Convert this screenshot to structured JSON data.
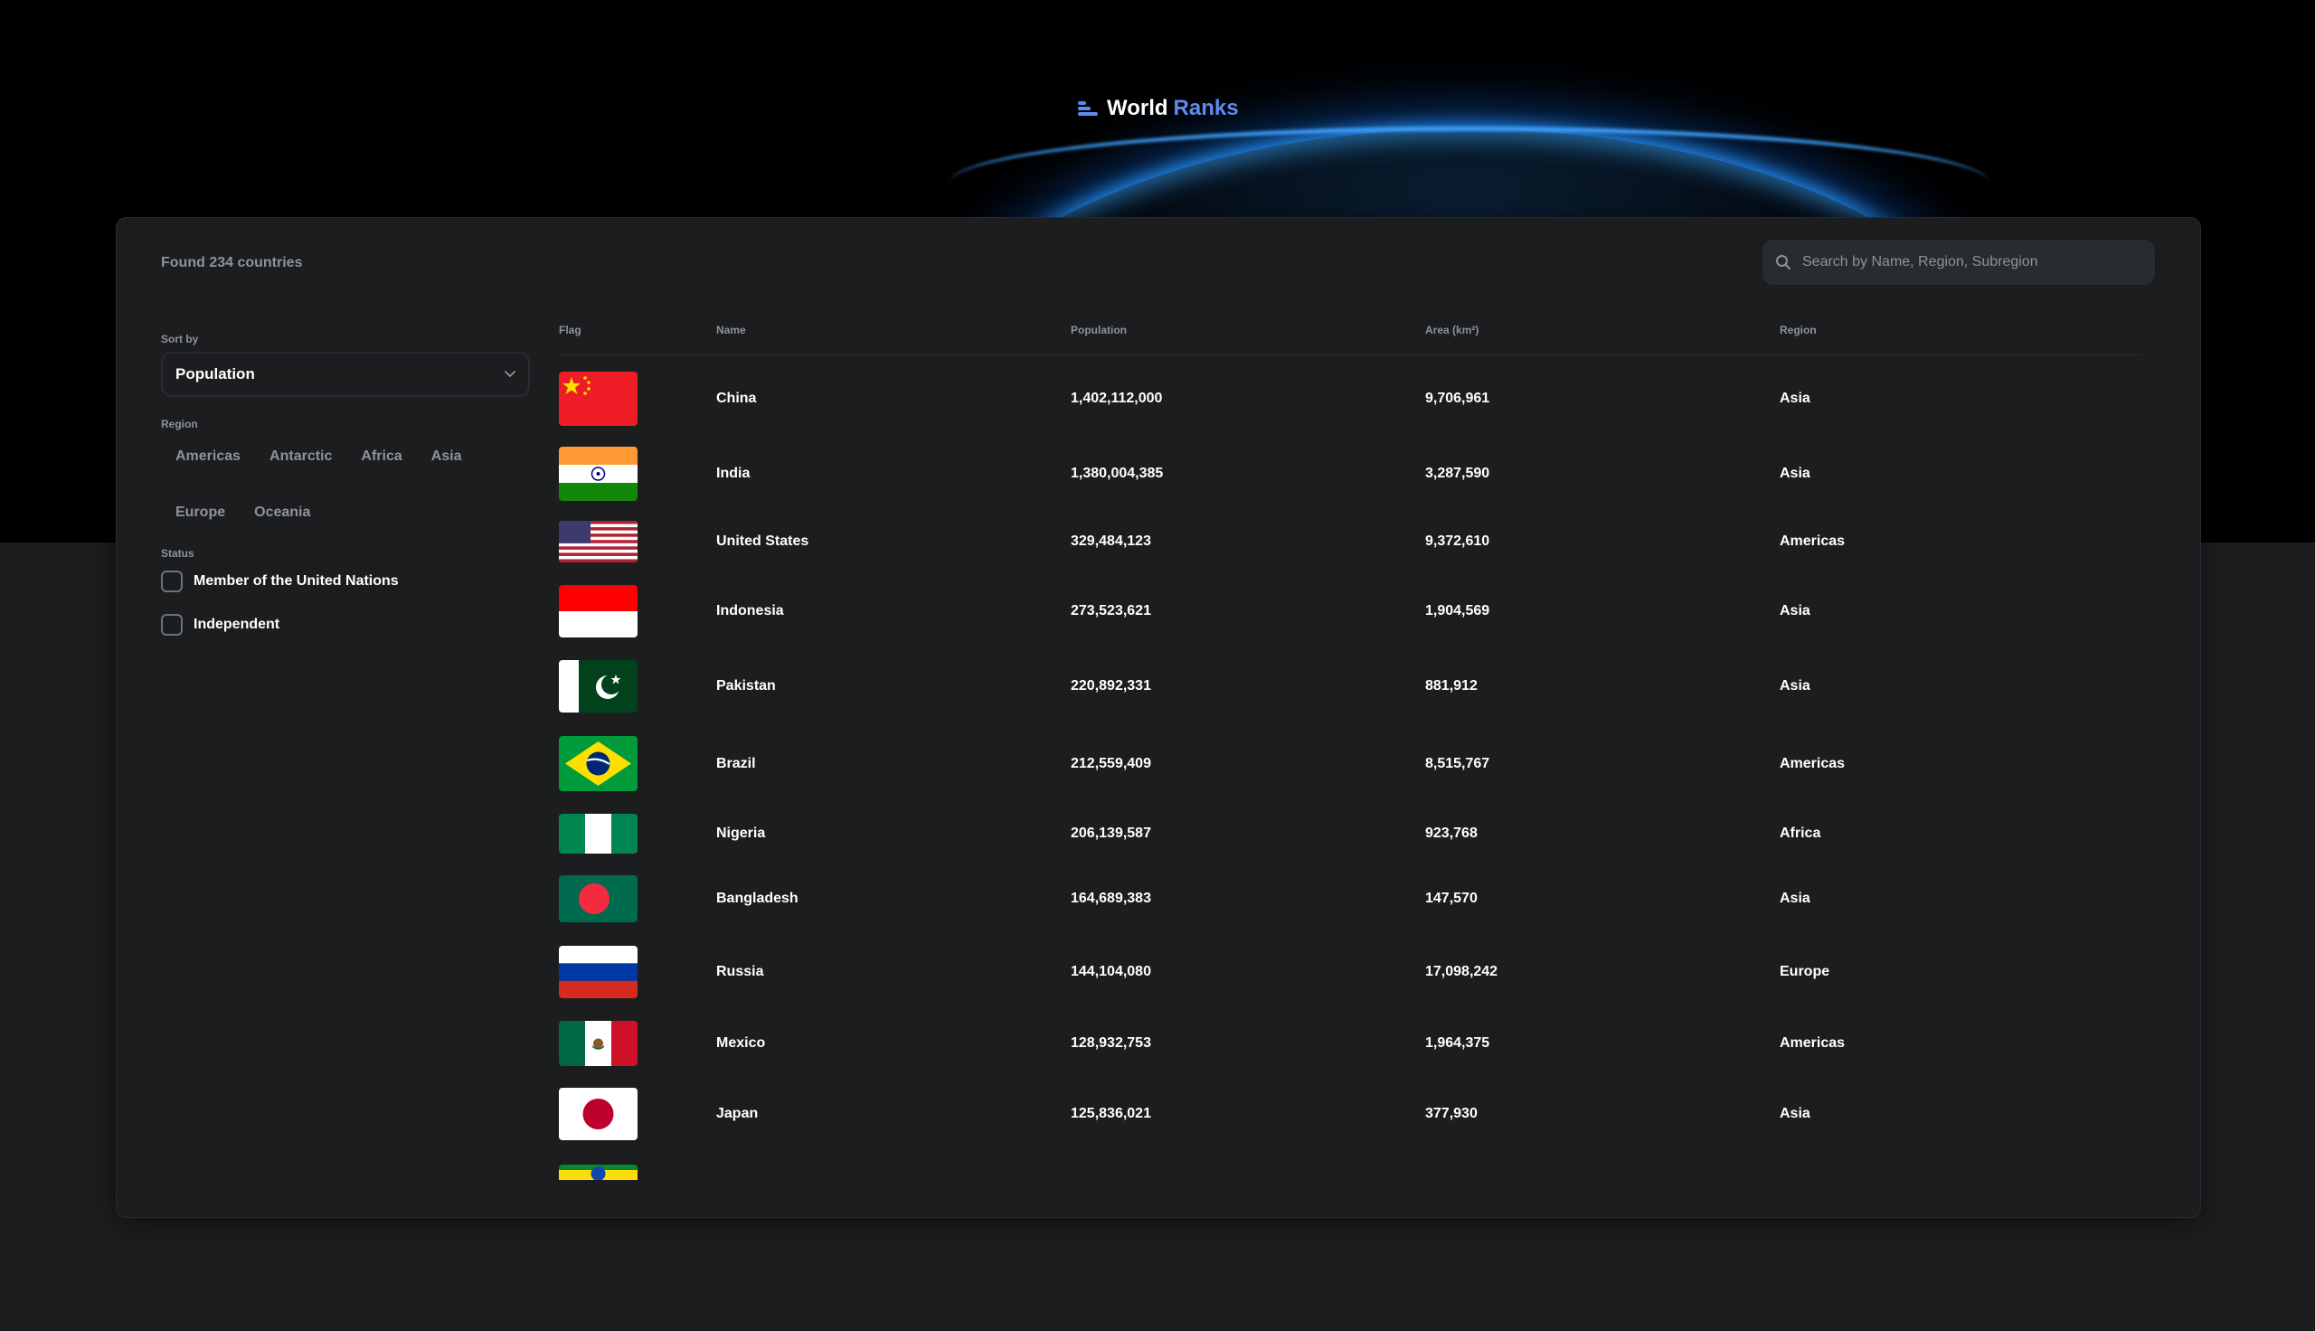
{
  "app": {
    "logo_word1": "World",
    "logo_word2": "Ranks"
  },
  "header": {
    "found_text": "Found 234 countries"
  },
  "search": {
    "placeholder": "Search by Name, Region, Subregion",
    "value": ""
  },
  "filters": {
    "sort_label": "Sort by",
    "sort_value": "Population",
    "region_label": "Region",
    "regions": [
      "Americas",
      "Antarctic",
      "Africa",
      "Asia",
      "Europe",
      "Oceania"
    ],
    "status_label": "Status",
    "status_options": [
      {
        "label": "Member of the United Nations",
        "checked": false
      },
      {
        "label": "Independent",
        "checked": false
      }
    ]
  },
  "table": {
    "columns": [
      "Flag",
      "Name",
      "Population",
      "Area (km²)",
      "Region"
    ],
    "rows": [
      {
        "flag": "china-flag",
        "name": "China",
        "population": "1,402,112,000",
        "area": "9,706,961",
        "region": "Asia"
      },
      {
        "flag": "india-flag",
        "name": "India",
        "population": "1,380,004,385",
        "area": "3,287,590",
        "region": "Asia"
      },
      {
        "flag": "united-states-flag",
        "name": "United States",
        "population": "329,484,123",
        "area": "9,372,610",
        "region": "Americas"
      },
      {
        "flag": "indonesia-flag",
        "name": "Indonesia",
        "population": "273,523,621",
        "area": "1,904,569",
        "region": "Asia"
      },
      {
        "flag": "pakistan-flag",
        "name": "Pakistan",
        "population": "220,892,331",
        "area": "881,912",
        "region": "Asia"
      },
      {
        "flag": "brazil-flag",
        "name": "Brazil",
        "population": "212,559,409",
        "area": "8,515,767",
        "region": "Americas"
      },
      {
        "flag": "nigeria-flag",
        "name": "Nigeria",
        "population": "206,139,587",
        "area": "923,768",
        "region": "Africa"
      },
      {
        "flag": "bangladesh-flag",
        "name": "Bangladesh",
        "population": "164,689,383",
        "area": "147,570",
        "region": "Asia"
      },
      {
        "flag": "russia-flag",
        "name": "Russia",
        "population": "144,104,080",
        "area": "17,098,242",
        "region": "Europe"
      },
      {
        "flag": "mexico-flag",
        "name": "Mexico",
        "population": "128,932,753",
        "area": "1,964,375",
        "region": "Americas"
      },
      {
        "flag": "japan-flag",
        "name": "Japan",
        "population": "125,836,021",
        "area": "377,930",
        "region": "Asia"
      },
      {
        "flag": "ethiopia-flag",
        "name": "",
        "population": "",
        "area": "",
        "region": ""
      }
    ]
  }
}
